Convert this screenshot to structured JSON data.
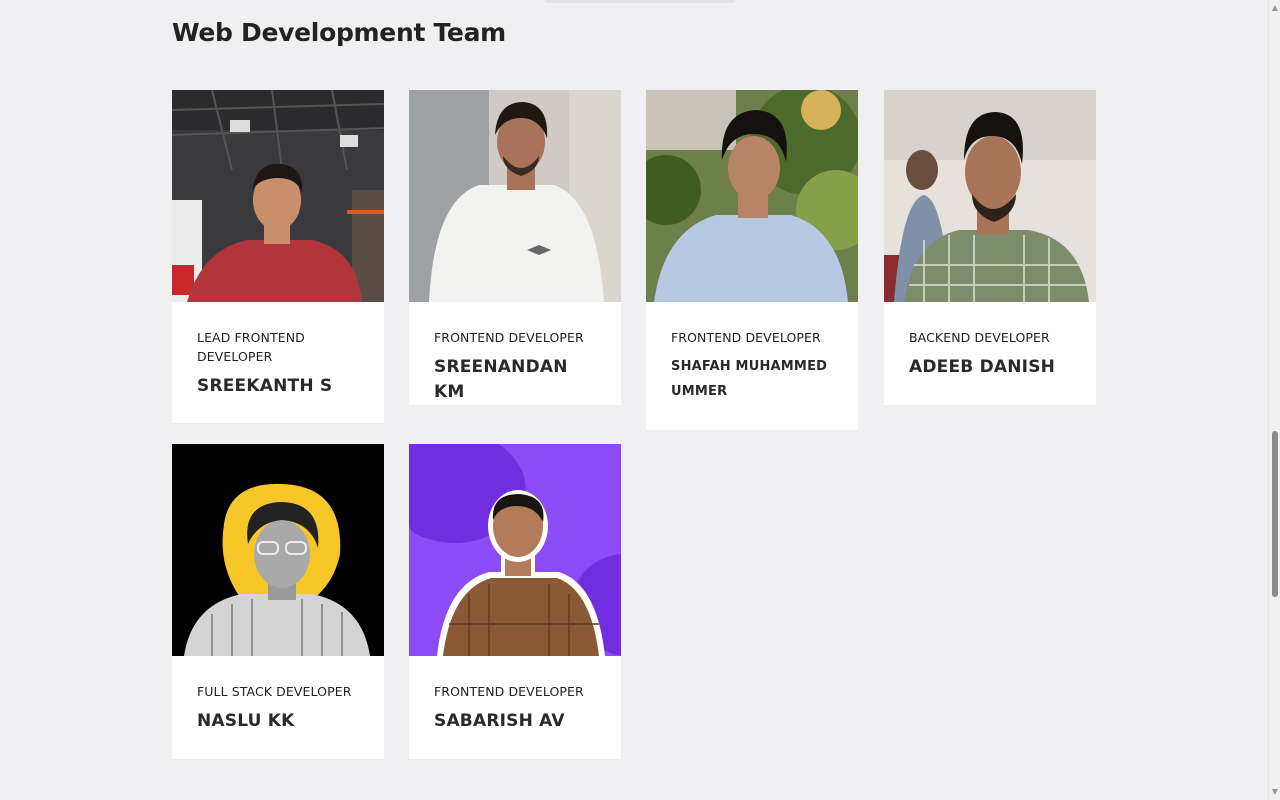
{
  "section": {
    "title": "Web Development Team"
  },
  "members": [
    {
      "role": "Lead Frontend Developer",
      "name": "Sreekanth S"
    },
    {
      "role": "Frontend Developer",
      "name": "Sreenandan KM"
    },
    {
      "role": "Frontend Developer",
      "name": "Shafah Muhammed Ummer"
    },
    {
      "role": "Backend Developer",
      "name": "Adeeb Danish"
    },
    {
      "role": "Full Stack Developer",
      "name": "Naslu KK"
    },
    {
      "role": "Frontend Developer",
      "name": "Sabarish AV"
    }
  ],
  "scrollbar": {
    "position_fraction": 0.69
  },
  "colors": {
    "background": "#f0f0f2",
    "card": "#ffffff",
    "text": "#222222",
    "accent_yellow": "#f7c72a",
    "accent_purple": "#8b4cf5"
  }
}
